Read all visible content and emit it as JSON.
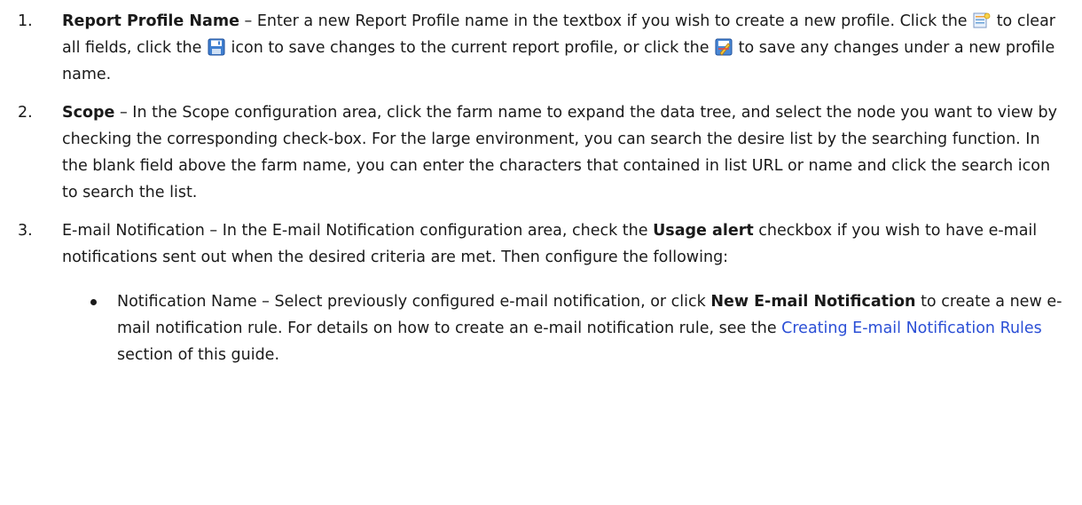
{
  "items": [
    {
      "number": "1.",
      "title": "Report Profile Name",
      "seg1": " – Enter a new Report Profile name in the textbox if you wish to create a new profile. Click the ",
      "seg2": " to clear all fields, click the ",
      "seg3": " icon to save changes to the current report profile, or click the ",
      "seg4": " to save any changes under a new profile name.",
      "icons": [
        "clear-fields-icon",
        "save-icon",
        "save-as-icon"
      ]
    },
    {
      "number": "2.",
      "title": "Scope",
      "text": " – In the Scope configuration area, click the farm name to expand the data tree, and select the node you want to view by checking the corresponding check-box. For the large environment, you can search the desire list by the searching function. In the blank field above the farm name, you can enter the characters that contained in list URL or name and click the search icon to search the list."
    },
    {
      "number": "3.",
      "lead": "E-mail Notification – In the E-mail Notification configuration area, check the ",
      "bold": "Usage alert",
      "text": " checkbox if you wish to have e-mail notifications sent out when the desired criteria are met. Then configure the following:",
      "subitems": [
        {
          "lead": "Notification Name – Select previously configured e-mail notification, or click ",
          "bold": "New E-mail Notification",
          "mid": " to create a new e-mail notification rule. For details on how to create an e-mail notification rule, see the ",
          "link": "Creating E-mail Notification Rules",
          "tail": " section of this guide."
        }
      ]
    }
  ],
  "colors": {
    "text": "#1a1a1a",
    "link": "#2b4fd6"
  }
}
